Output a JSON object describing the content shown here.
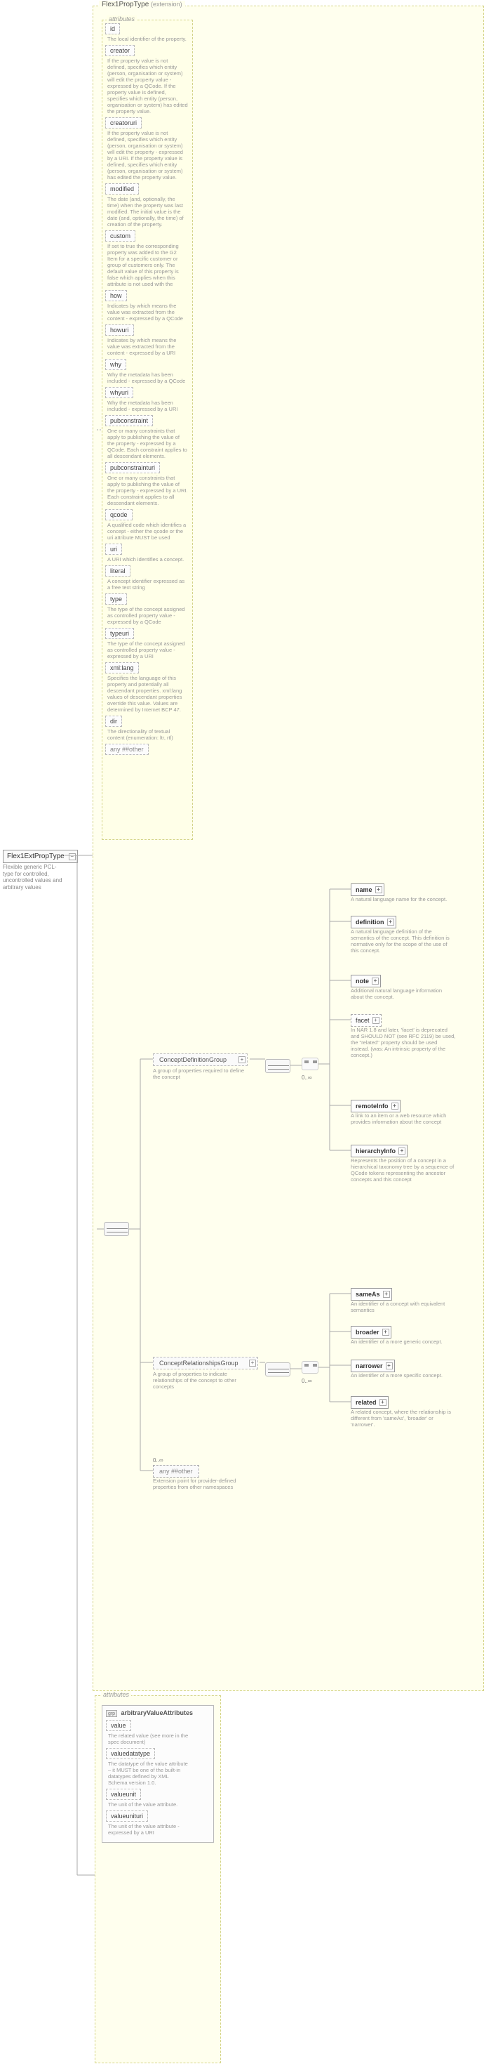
{
  "root": {
    "name": "Flex1ExtPropType",
    "desc": "Flexible generic PCL-type for controlled, uncontrolled values and arbitrary values"
  },
  "main": {
    "title": "Flex1PropType",
    "ext": "(extension)"
  },
  "attrbox": {
    "title": "attributes"
  },
  "attrs": [
    {
      "name": "id",
      "desc": "The local identifier of the property."
    },
    {
      "name": "creator",
      "desc": "If the property value is not defined, specifies which entity (person, organisation or system) will edit the property value - expressed by a QCode. If the property value is defined, specifies which entity (person, organisation or system) has edited the property value."
    },
    {
      "name": "creatoruri",
      "desc": "If the property value is not defined, specifies which entity (person, organisation or system) will edit the property - expressed by a URI. If the property value is defined, specifies which entity (person, organisation or system) has edited the property value."
    },
    {
      "name": "modified",
      "desc": "The date (and, optionally, the time) when the property was last modified. The initial value is the date (and, optionally, the time) of creation of the property."
    },
    {
      "name": "custom",
      "desc": "If set to true the corresponding property was added to the G2 Item for a specific customer or group of customers only. The default value of this property is false which applies when this attribute is not used with the"
    },
    {
      "name": "how",
      "desc": "Indicates by which means the value was extracted from the content - expressed by a QCode"
    },
    {
      "name": "howuri",
      "desc": "Indicates by which means the value was extracted from the content - expressed by a URI"
    },
    {
      "name": "why",
      "desc": "Why the metadata has been included - expressed by a QCode"
    },
    {
      "name": "whyuri",
      "desc": "Why the metadata has been included - expressed by a URI"
    },
    {
      "name": "pubconstraint",
      "desc": "One or many constraints that apply to publishing the value of the property - expressed by a QCode. Each constraint applies to all descendant elements."
    },
    {
      "name": "pubconstrainturi",
      "desc": "One or many constraints that apply to publishing the value of the property - expressed by a URI. Each constraint applies to all descendant elements."
    },
    {
      "name": "qcode",
      "desc": "A qualified code which identifies a concept - either the qcode or the uri attribute MUST be used"
    },
    {
      "name": "uri",
      "desc": "A URI which identifies a concept."
    },
    {
      "name": "literal",
      "desc": "A concept identifier expressed as a free text string"
    },
    {
      "name": "type",
      "desc": "The type of the concept assigned as controlled property value - expressed by a QCode"
    },
    {
      "name": "typeuri",
      "desc": "The type of the concept assigned as controlled property value - expressed by a URI"
    },
    {
      "name": "xml:lang",
      "desc": "Specifies the language of this property and potentially all descendant properties. xml:lang values of descendant properties override this value. Values are determined by Internet BCP 47."
    },
    {
      "name": "dir",
      "desc": "The directionality of textual content (enumeration: ltr, rtl)"
    }
  ],
  "attrs_other": "any ##other",
  "groups": {
    "cdg": {
      "name": "ConceptDefinitionGroup",
      "desc": "A group of properties required to define the concept"
    },
    "crg": {
      "name": "ConceptRelationshipsGroup",
      "desc": "A group of properties to indicate relationships of the concept to other concepts"
    }
  },
  "elements": {
    "name": {
      "label": "name",
      "desc": "A natural language name for the concept."
    },
    "definition": {
      "label": "definition",
      "desc": "A natural language definition of the semantics of the concept. This definition is normative only for the scope of the use of this concept."
    },
    "note": {
      "label": "note",
      "desc": "Additional natural language information about the concept."
    },
    "facet": {
      "label": "facet",
      "desc": "In NAR 1.8 and later, 'facet' is deprecated and SHOULD NOT (see RFC 2119) be used, the \"related\" property should be used instead. (was: An intrinsic property of the concept.)"
    },
    "remoteInfo": {
      "label": "remoteInfo",
      "desc": "A link to an item or a web resource which provides information about the concept"
    },
    "hierarchyInfo": {
      "label": "hierarchyInfo",
      "desc": "Represents the position of a concept in a hierarchical taxonomy tree by a sequence of QCode tokens representing the ancestor concepts and this concept"
    },
    "sameAs": {
      "label": "sameAs",
      "desc": "An identifier of a concept with equivalent semantics"
    },
    "broader": {
      "label": "broader",
      "desc": "An identifier of a more generic concept."
    },
    "narrower": {
      "label": "narrower",
      "desc": "An identifier of a more specific concept."
    },
    "related": {
      "label": "related",
      "desc": "A related concept, where the relationship is different from 'sameAs', 'broader' or 'narrower'."
    }
  },
  "anyother": {
    "label": "any ##other",
    "desc": "Extension point for provider-defined properties from other namespaces"
  },
  "occ": "0..∞",
  "attrs2": {
    "title": "attributes",
    "group": "arbitraryValueAttributes",
    "grpicon": "grp",
    "items": [
      {
        "name": "value",
        "desc": "The related value (see more in the spec document)"
      },
      {
        "name": "valuedatatype",
        "desc": "The datatype of the value attribute – it MUST be one of the built-in datatypes defined by XML Schema version 1.0."
      },
      {
        "name": "valueunit",
        "desc": "The unit of the value attribute."
      },
      {
        "name": "valueunituri",
        "desc": "The unit of the value attribute - expressed by a URI"
      }
    ]
  }
}
